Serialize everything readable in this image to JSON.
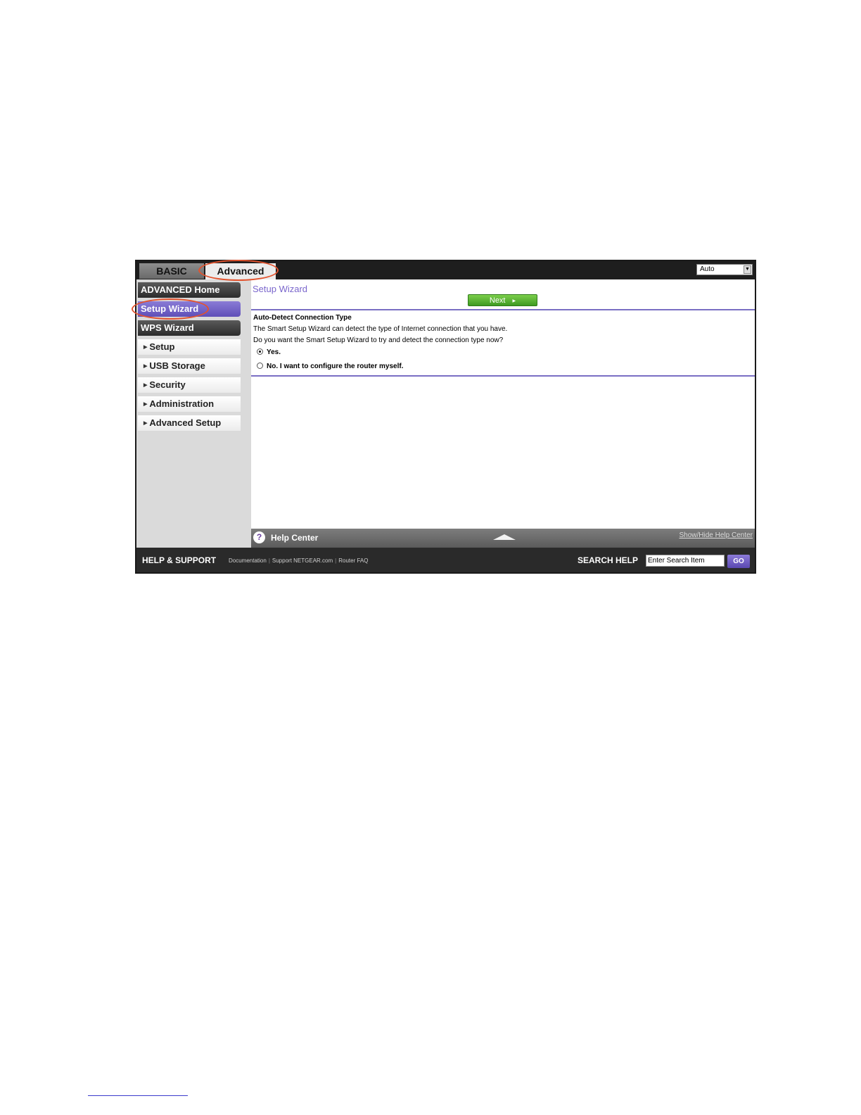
{
  "topbar": {
    "tab_basic": "BASIC",
    "tab_advanced": "Advanced",
    "select_value": "Auto"
  },
  "sidebar": {
    "items": [
      {
        "label": "ADVANCED Home"
      },
      {
        "label": "Setup Wizard"
      },
      {
        "label": "WPS Wizard"
      },
      {
        "label": "Setup"
      },
      {
        "label": "USB Storage"
      },
      {
        "label": "Security"
      },
      {
        "label": "Administration"
      },
      {
        "label": "Advanced Setup"
      }
    ]
  },
  "main": {
    "title": "Setup Wizard",
    "next_label": "Next",
    "section_title": "Auto-Detect Connection Type",
    "line1": "The Smart Setup Wizard can detect the type of Internet connection that you have.",
    "line2": "Do you want the Smart Setup Wizard to try and detect the connection type now?",
    "radio_yes": "Yes.",
    "radio_no": "No. I want to configure the router myself.",
    "selected": "yes"
  },
  "help": {
    "label": "Help Center",
    "toggle": "Show/Hide Help Center"
  },
  "footer": {
    "title": "HELP & SUPPORT",
    "links": [
      "Documentation",
      "Support NETGEAR.com",
      "Router FAQ"
    ],
    "search_label": "SEARCH HELP",
    "search_value": "Enter Search Item",
    "go_label": "GO"
  },
  "colors": {
    "accent_purple": "#7a66cc",
    "next_green": "#4caf2a",
    "highlight_oval": "#e2532e"
  }
}
